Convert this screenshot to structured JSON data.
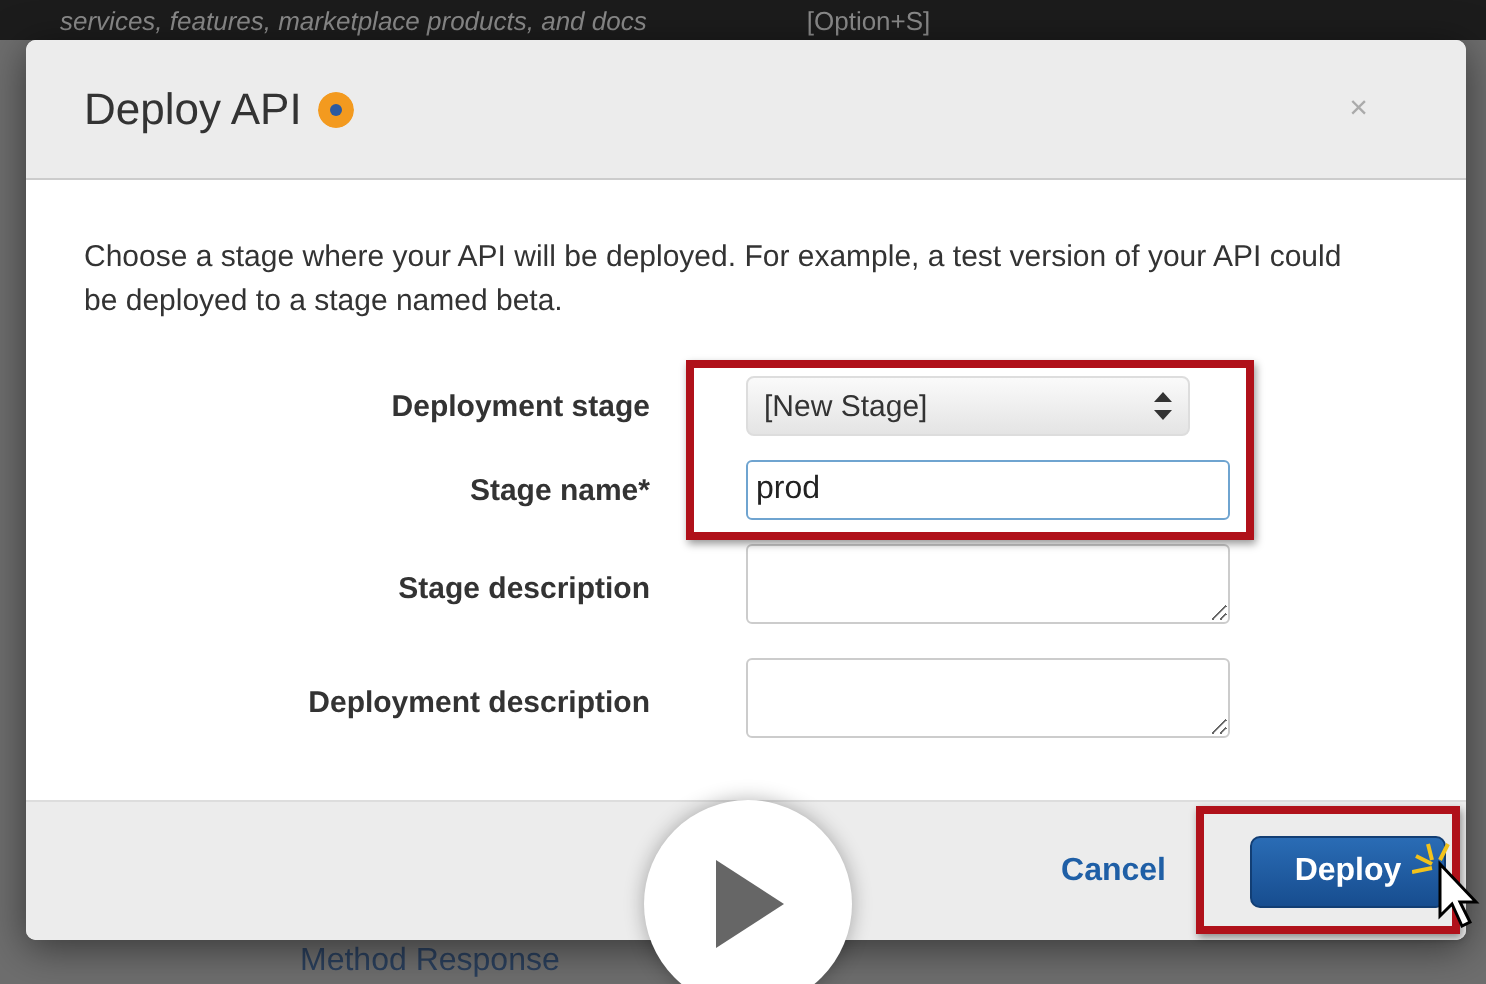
{
  "background": {
    "search_hint": "services, features, marketplace products, and docs",
    "shortcut": "[Option+S]",
    "section_title": "Method Response"
  },
  "dialog": {
    "title": "Deploy API",
    "close": "×",
    "description": "Choose a stage where your API will be deployed. For example, a test version of your API could be deployed to a stage named beta.",
    "fields": [
      {
        "label": "Deployment stage",
        "kind": "select",
        "value": "[New Stage]"
      },
      {
        "label": "Stage name*",
        "kind": "input",
        "value": "prod"
      },
      {
        "label": "Stage description",
        "kind": "textarea"
      },
      {
        "label": "Deployment description",
        "kind": "textarea"
      }
    ],
    "buttons": [
      {
        "label": "Cancel",
        "kind": "link"
      },
      {
        "label": "Deploy",
        "kind": "primary"
      }
    ]
  }
}
